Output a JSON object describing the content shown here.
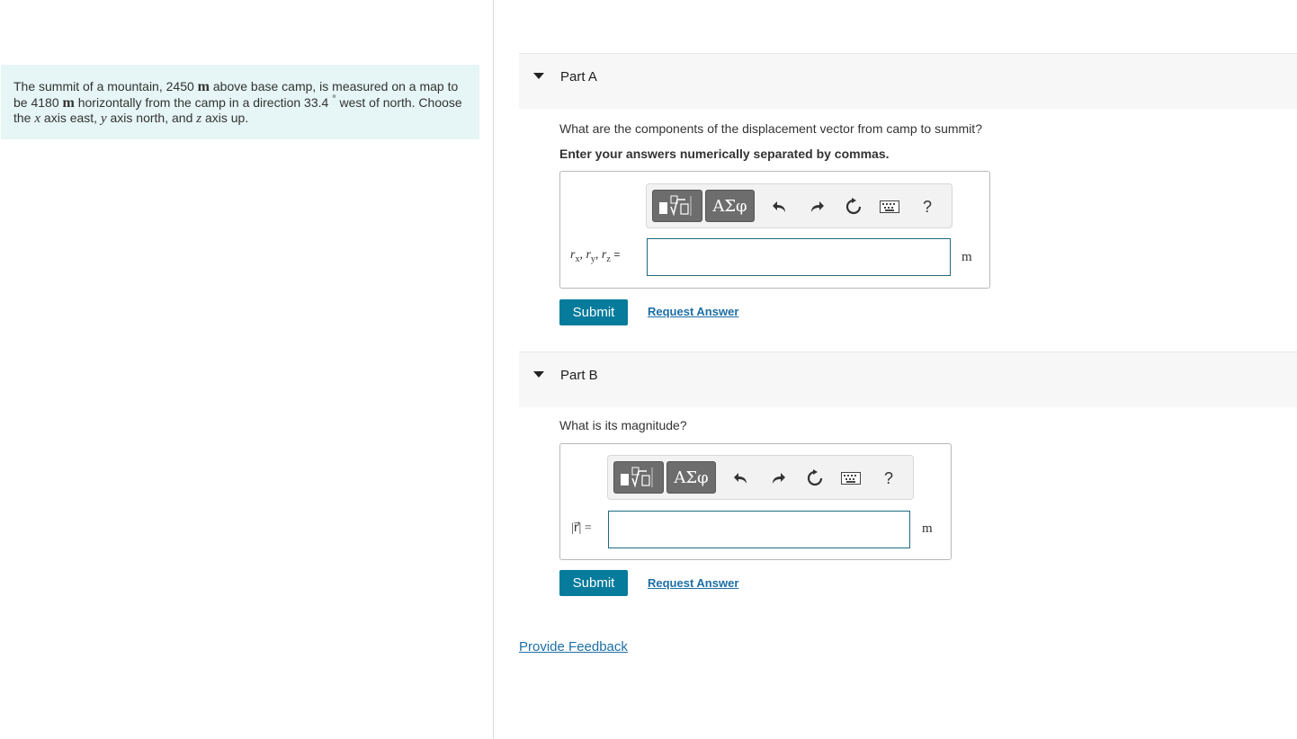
{
  "problem": {
    "text_1": "The summit of a mountain, 2450 ",
    "unit_m": "m",
    "text_2": " above base camp, is measured on a map to be 4180 ",
    "text_3": " horizontally from the camp in a direction 33.4 ",
    "degree": "°",
    "text_4": " west of north. Choose the ",
    "var_x": "x",
    "text_5": " axis east, ",
    "var_y": "y",
    "text_6": " axis north, and ",
    "var_z": "z",
    "text_7": " axis up."
  },
  "part_a": {
    "title": "Part A",
    "question": "What are the components of the displacement vector from camp to summit?",
    "instruction": "Enter your answers numerically separated by commas.",
    "label_r": "r",
    "sub_x": "x",
    "sub_y": "y",
    "sub_z": "z",
    "comma": ", ",
    "equals": "=",
    "input_value": "",
    "unit": "m",
    "submit_label": "Submit",
    "request_label": "Request Answer"
  },
  "part_b": {
    "title": "Part B",
    "question": "What is its magnitude?",
    "label": "|r⃗| =",
    "input_value": "",
    "unit": "m",
    "submit_label": "Submit",
    "request_label": "Request Answer"
  },
  "toolbar": {
    "greek_label": "ΑΣφ",
    "help_label": "?",
    "icons": [
      "templates-icon",
      "greek-symbols-icon",
      "undo-icon",
      "redo-icon",
      "reset-icon",
      "keyboard-icon",
      "help-icon"
    ]
  },
  "feedback_label": "Provide Feedback"
}
